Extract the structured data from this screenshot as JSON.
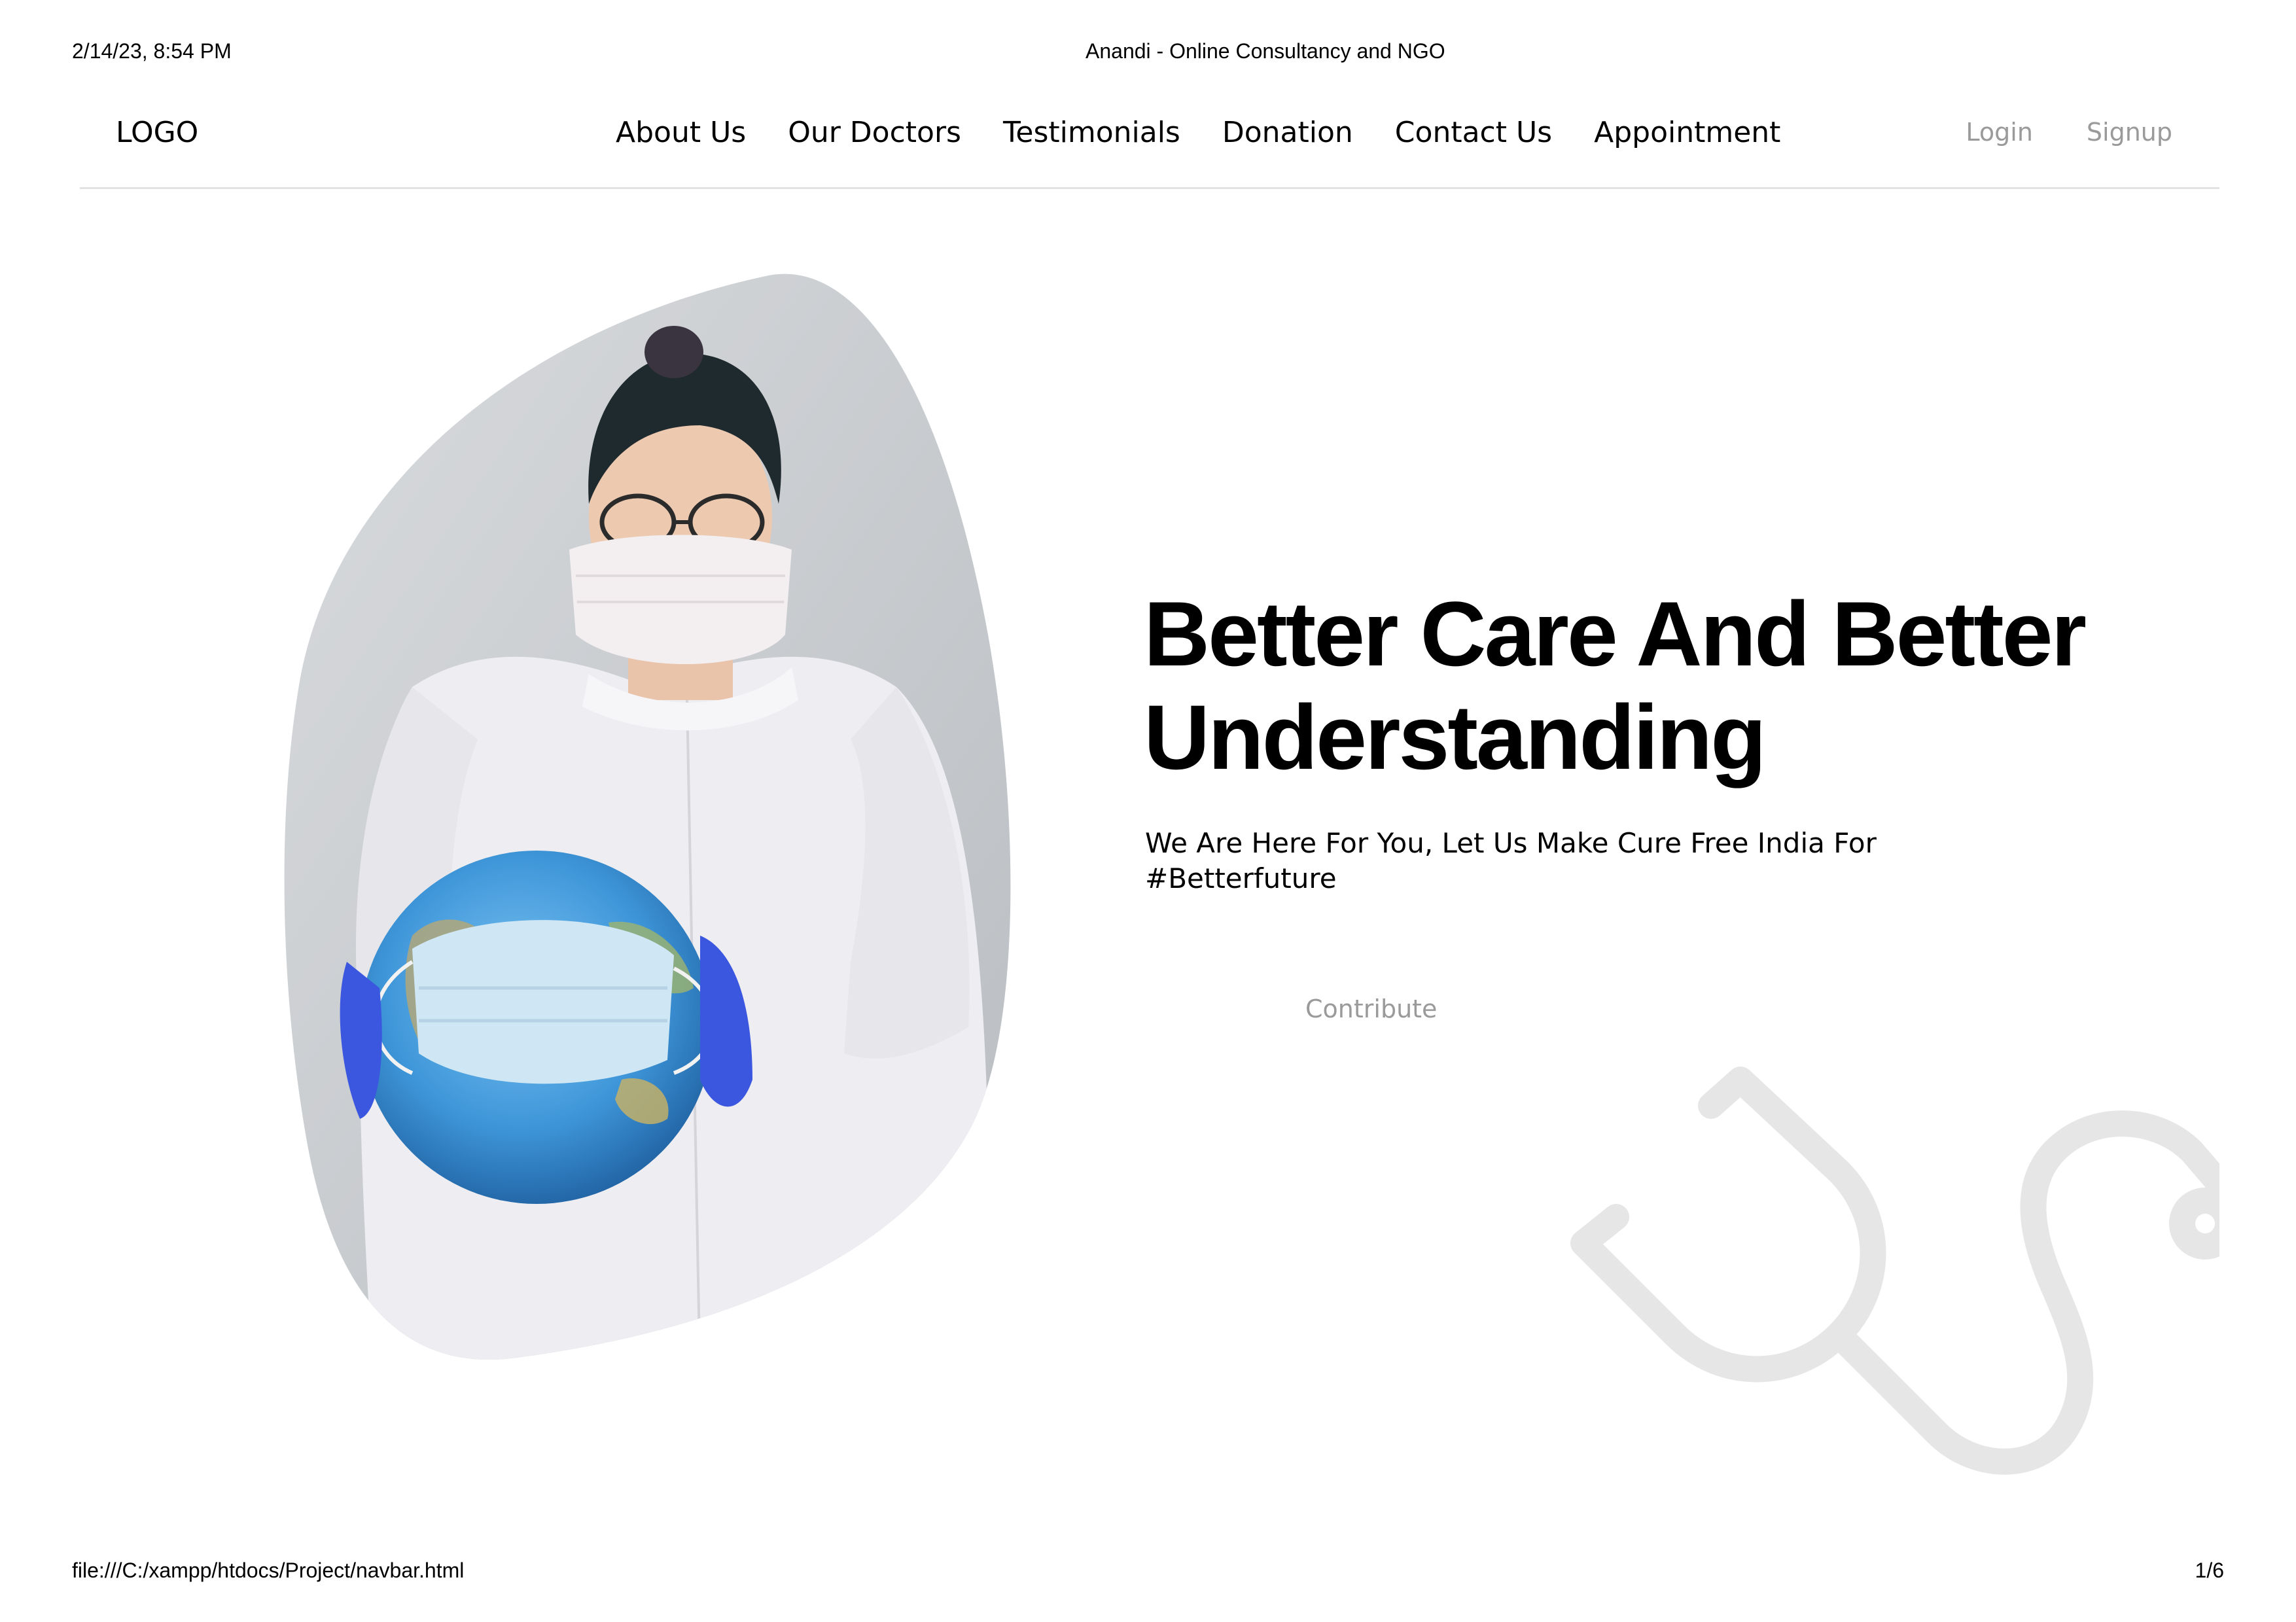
{
  "print": {
    "datetime": "2/14/23, 8:54 PM",
    "page_title": "Anandi - Online Consultancy and NGO",
    "file_path": "file:///C:/xampp/htdocs/Project/navbar.html",
    "page_number": "1/6"
  },
  "navbar": {
    "logo": "LOGO",
    "links": [
      "About Us",
      "Our Doctors",
      "Testimonials",
      "Donation",
      "Contact Us",
      "Appointment"
    ],
    "login": "Login",
    "signup": "Signup"
  },
  "hero": {
    "title_line1": "Better Care And Better",
    "title_line2": "Understanding",
    "subtitle_line1": "We Are Here For You, Let Us Make Cure Free India For",
    "subtitle_line2": "#Betterfuture",
    "cta": "Contribute"
  },
  "colors": {
    "muted_text": "#9a9a9a",
    "divider": "#e2e2e2",
    "watermark": "#e6e6e6",
    "blob_bg": "#c9cccf"
  }
}
